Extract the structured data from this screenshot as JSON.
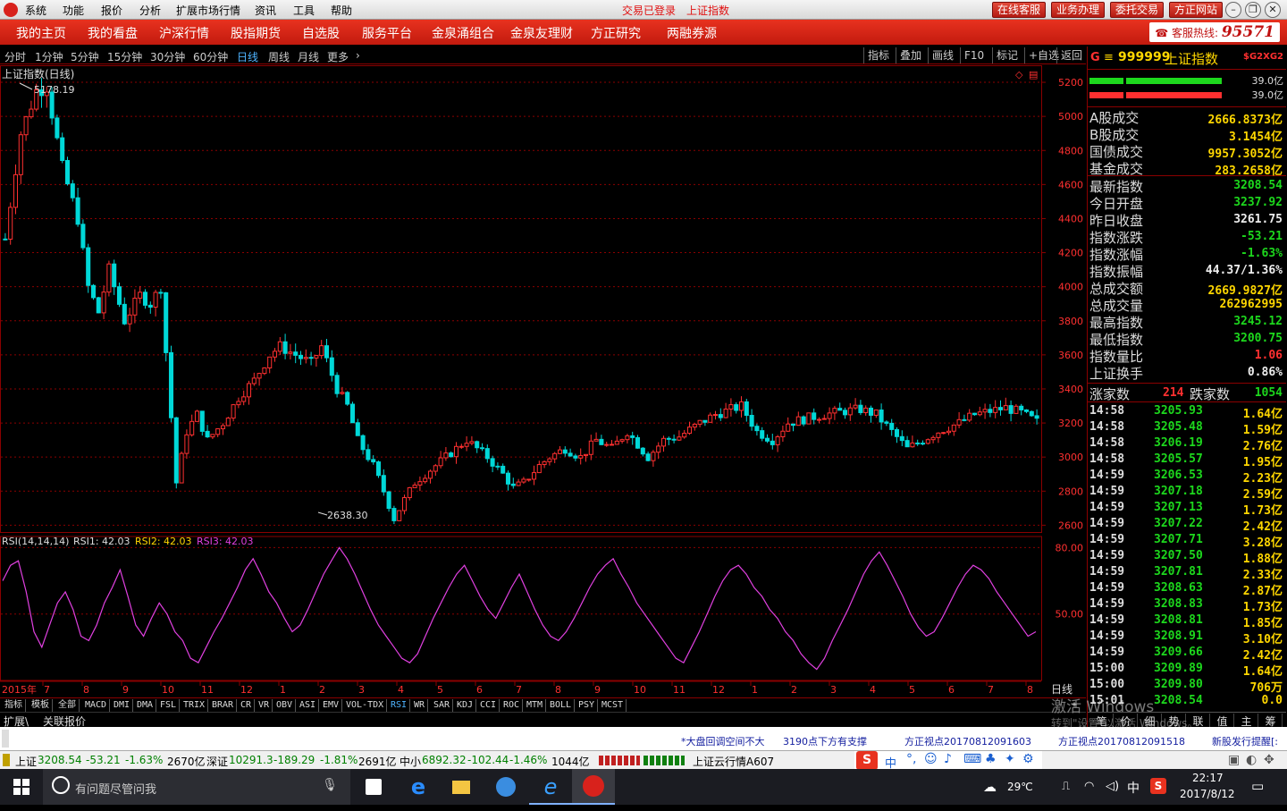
{
  "menubar": {
    "items": [
      "系统",
      "功能",
      "报价",
      "分析",
      "扩展市场行情",
      "资讯",
      "工具",
      "帮助"
    ],
    "status_login": "交易已登录",
    "status_index": "上证指数",
    "buttons": [
      "在线客服",
      "业务办理",
      "委托交易",
      "方正网站"
    ]
  },
  "navbar": {
    "items": [
      "我的主页",
      "我的看盘",
      "沪深行情",
      "股指期货",
      "自选股",
      "服务平台",
      "金泉涌组合",
      "金泉友理财",
      "方正研究",
      "两融券源"
    ],
    "hotline_label": "客服热线:",
    "hotline_number": "95571"
  },
  "periodbar": {
    "periods": [
      "分时",
      "1分钟",
      "5分钟",
      "15分钟",
      "30分钟",
      "60分钟",
      "日线",
      "周线",
      "月线",
      "更多"
    ],
    "active_period": "日线",
    "more_arrow": "›",
    "tools": [
      "指标",
      "叠加",
      "画线",
      "F10",
      "标记",
      "+自选",
      "返回"
    ]
  },
  "sidebar": {
    "header_g": "G",
    "header_menu": "≡",
    "code": "999999",
    "name": "上证指数",
    "tag": "$G2XG2",
    "bar1_value": "39.0亿",
    "bar2_value": "39.0亿",
    "turnover": [
      {
        "label": "A股成交",
        "value": "2666.8373亿"
      },
      {
        "label": "B股成交",
        "value": "3.1454亿"
      },
      {
        "label": "国债成交",
        "value": "9957.3052亿"
      },
      {
        "label": "基金成交",
        "value": "283.2658亿"
      }
    ],
    "stats": [
      {
        "label": "最新指数",
        "value": "3208.54",
        "color": "#1dd81d"
      },
      {
        "label": "今日开盘",
        "value": "3237.92",
        "color": "#1dd81d"
      },
      {
        "label": "昨日收盘",
        "value": "3261.75",
        "color": "#eeeeee"
      },
      {
        "label": "指数涨跌",
        "value": "-53.21",
        "color": "#1dd81d"
      },
      {
        "label": "指数涨幅",
        "value": "-1.63%",
        "color": "#1dd81d"
      },
      {
        "label": "指数振幅",
        "value": "44.37/1.36%",
        "color": "#eeeeee"
      },
      {
        "label": "总成交额",
        "value": "2669.9827亿",
        "color": "#ffd700"
      },
      {
        "label": "总成交量",
        "value": "262962995",
        "color": "#ffd700"
      },
      {
        "label": "最高指数",
        "value": "3245.12",
        "color": "#1dd81d"
      },
      {
        "label": "最低指数",
        "value": "3200.75",
        "color": "#1dd81d"
      },
      {
        "label": "指数量比",
        "value": "1.06",
        "color": "#ff3030"
      },
      {
        "label": "上证换手",
        "value": "0.86%",
        "color": "#eeeeee"
      }
    ],
    "rise_label": "涨家数",
    "rise_value": "214",
    "fall_label": "跌家数",
    "fall_value": "1054",
    "ticks": [
      {
        "time": "14:58",
        "price": "3205.93",
        "vol": "1.64亿"
      },
      {
        "time": "14:58",
        "price": "3205.48",
        "vol": "1.59亿"
      },
      {
        "time": "14:58",
        "price": "3206.19",
        "vol": "2.76亿"
      },
      {
        "time": "14:58",
        "price": "3205.57",
        "vol": "1.95亿"
      },
      {
        "time": "14:59",
        "price": "3206.53",
        "vol": "2.23亿"
      },
      {
        "time": "14:59",
        "price": "3207.18",
        "vol": "2.59亿"
      },
      {
        "time": "14:59",
        "price": "3207.13",
        "vol": "1.73亿"
      },
      {
        "time": "14:59",
        "price": "3207.22",
        "vol": "2.42亿"
      },
      {
        "time": "14:59",
        "price": "3207.71",
        "vol": "3.28亿"
      },
      {
        "time": "14:59",
        "price": "3207.50",
        "vol": "1.88亿"
      },
      {
        "time": "14:59",
        "price": "3207.81",
        "vol": "2.33亿"
      },
      {
        "time": "14:59",
        "price": "3208.63",
        "vol": "2.87亿"
      },
      {
        "time": "14:59",
        "price": "3208.83",
        "vol": "1.73亿"
      },
      {
        "time": "14:59",
        "price": "3208.81",
        "vol": "1.85亿"
      },
      {
        "time": "14:59",
        "price": "3208.91",
        "vol": "3.10亿"
      },
      {
        "time": "14:59",
        "price": "3209.66",
        "vol": "2.42亿"
      },
      {
        "time": "15:00",
        "price": "3209.89",
        "vol": "1.64亿"
      },
      {
        "time": "15:00",
        "price": "3209.80",
        "vol": "706万"
      },
      {
        "time": "15:01",
        "price": "3208.54",
        "vol": "0.0"
      }
    ],
    "bottom_tabs": [
      "笔",
      "价",
      "细",
      "势",
      "联",
      "值",
      "主",
      "筹"
    ]
  },
  "tabs1": {
    "items": [
      "指标",
      "模板",
      "全部",
      "MACD",
      "DMI",
      "DMA",
      "FSL",
      "TRIX",
      "BRAR",
      "CR",
      "VR",
      "OBV",
      "ASI",
      "EMV",
      "VOL-TDX",
      "RSI",
      "WR",
      "SAR",
      "KDJ",
      "CCI",
      "ROC",
      "MTM",
      "BOLL",
      "PSY",
      "MCST"
    ],
    "active": "RSI",
    "right_plus": "+"
  },
  "tabs2": {
    "items": [
      "扩展\\",
      "关联报价"
    ]
  },
  "chart_data": {
    "type": "candlestick",
    "title": "上证指数(日线)",
    "high_label": "5178.19",
    "low_label": "2638.30",
    "y_ticks": [
      "5200",
      "5000",
      "4800",
      "4600",
      "4400",
      "4200",
      "4000",
      "3800",
      "3600",
      "3400",
      "3200",
      "3000",
      "2800",
      "2600"
    ],
    "ylim": [
      2560,
      5300
    ],
    "x_year_label": "2015年",
    "x_month_labels": [
      "7",
      "8",
      "9",
      "10",
      "11",
      "12",
      "1",
      "2",
      "3",
      "4",
      "5",
      "6",
      "7",
      "8",
      "9",
      "10",
      "11",
      "12",
      "1",
      "2",
      "3",
      "4",
      "5",
      "6",
      "7",
      "8"
    ],
    "x_right_label": "日线",
    "price_path": [
      [
        0,
        4280
      ],
      [
        3,
        4900
      ],
      [
        6,
        5150
      ],
      [
        8,
        5178
      ],
      [
        11,
        4700
      ],
      [
        14,
        4400
      ],
      [
        16,
        4000
      ],
      [
        18,
        3850
      ],
      [
        20,
        4100
      ],
      [
        23,
        3800
      ],
      [
        26,
        3950
      ],
      [
        28,
        3900
      ],
      [
        30,
        4000
      ],
      [
        33,
        2850
      ],
      [
        35,
        3150
      ],
      [
        37,
        3250
      ],
      [
        39,
        3100
      ],
      [
        42,
        3200
      ],
      [
        45,
        3350
      ],
      [
        48,
        3450
      ],
      [
        51,
        3600
      ],
      [
        53,
        3650
      ],
      [
        56,
        3600
      ],
      [
        59,
        3550
      ],
      [
        61,
        3650
      ],
      [
        64,
        3400
      ],
      [
        66,
        3300
      ],
      [
        68,
        3100
      ],
      [
        71,
        2950
      ],
      [
        73,
        2800
      ],
      [
        75,
        2638
      ],
      [
        77,
        2750
      ],
      [
        79,
        2850
      ],
      [
        81,
        2900
      ],
      [
        83,
        2950
      ],
      [
        85,
        3000
      ],
      [
        87,
        3050
      ],
      [
        89,
        3100
      ],
      [
        91,
        3050
      ],
      [
        93,
        3000
      ],
      [
        96,
        2900
      ],
      [
        98,
        2820
      ],
      [
        100,
        2850
      ],
      [
        103,
        2950
      ],
      [
        105,
        3000
      ],
      [
        108,
        3050
      ],
      [
        111,
        3000
      ],
      [
        114,
        3100
      ],
      [
        117,
        3050
      ],
      [
        120,
        3150
      ],
      [
        124,
        3000
      ],
      [
        127,
        3100
      ],
      [
        130,
        3120
      ],
      [
        134,
        3200
      ],
      [
        137,
        3250
      ],
      [
        140,
        3280
      ],
      [
        142,
        3300
      ],
      [
        145,
        3150
      ],
      [
        148,
        3100
      ],
      [
        151,
        3200
      ],
      [
        155,
        3230
      ],
      [
        158,
        3250
      ],
      [
        162,
        3270
      ],
      [
        165,
        3280
      ],
      [
        168,
        3250
      ],
      [
        171,
        3150
      ],
      [
        174,
        3050
      ],
      [
        177,
        3100
      ],
      [
        180,
        3150
      ],
      [
        184,
        3200
      ],
      [
        187,
        3250
      ],
      [
        190,
        3270
      ],
      [
        193,
        3290
      ],
      [
        196,
        3260
      ],
      [
        199,
        3208
      ]
    ],
    "indicator": {
      "name": "RSI(14,14,14)",
      "rsi1_label": "RSI1:",
      "rsi1": "42.03",
      "rsi2_label": "RSI2:",
      "rsi2": "42.03",
      "rsi3_label": "RSI3:",
      "rsi3": "42.03",
      "y_ticks": [
        "80.00",
        "50.00"
      ],
      "ylim": [
        20,
        85
      ],
      "values": [
        65,
        72,
        74,
        60,
        42,
        35,
        45,
        55,
        60,
        52,
        40,
        38,
        45,
        55,
        62,
        70,
        58,
        45,
        40,
        48,
        55,
        50,
        42,
        38,
        30,
        28,
        35,
        42,
        48,
        55,
        62,
        70,
        75,
        68,
        60,
        55,
        48,
        42,
        45,
        52,
        60,
        68,
        74,
        80,
        75,
        68,
        60,
        52,
        45,
        40,
        35,
        30,
        28,
        32,
        40,
        48,
        55,
        62,
        68,
        72,
        65,
        58,
        52,
        48,
        55,
        62,
        68,
        60,
        52,
        45,
        40,
        38,
        42,
        48,
        55,
        62,
        68,
        72,
        75,
        68,
        62,
        55,
        50,
        45,
        40,
        35,
        30,
        28,
        35,
        42,
        50,
        58,
        65,
        70,
        72,
        68,
        62,
        58,
        52,
        48,
        42,
        38,
        32,
        28,
        25,
        30,
        38,
        45,
        52,
        60,
        68,
        74,
        78,
        72,
        65,
        58,
        50,
        44,
        40,
        42,
        48,
        55,
        62,
        68,
        72,
        70,
        66,
        60,
        55,
        50,
        45,
        40,
        42
      ]
    }
  },
  "newsbar": {
    "items": [
      "*大盘回调空间不大",
      "3190点下方有支撑",
      "方正视点20170812091603",
      "方正视点20170812091518",
      "新股发行提醒[:"
    ],
    "watermark1": "激活 Windows",
    "watermark2": "转到\"设置\"以激活 Windows。"
  },
  "statusbar": {
    "sh_label": "上证",
    "sh_value": "3208.54",
    "sh_change": "-53.21",
    "sh_pct": "-1.63%",
    "sh_amount": "2670亿",
    "sz_label": "深证",
    "sz_value": "10291.3",
    "sz_change": "-189.29",
    "sz_pct": "-1.81%",
    "sz_amount": "2691亿",
    "zx_label": "中小",
    "zx_value": "6892.32",
    "zx_change": "-102.44",
    "zx_pct": "-1.46%",
    "zx_amount": "1044亿",
    "cloud": "上证云行情A607",
    "ime_lang": "中"
  },
  "taskbar": {
    "search_placeholder": "有问题尽管问我",
    "weather": "29℃",
    "ime": "中",
    "time": "22:17",
    "date": "2017/8/12"
  },
  "colors": {
    "up": "#ff3030",
    "down": "#00d8d8",
    "rsi": "#e040e0",
    "grid": "#8b0000",
    "accent": "#d8221c"
  }
}
